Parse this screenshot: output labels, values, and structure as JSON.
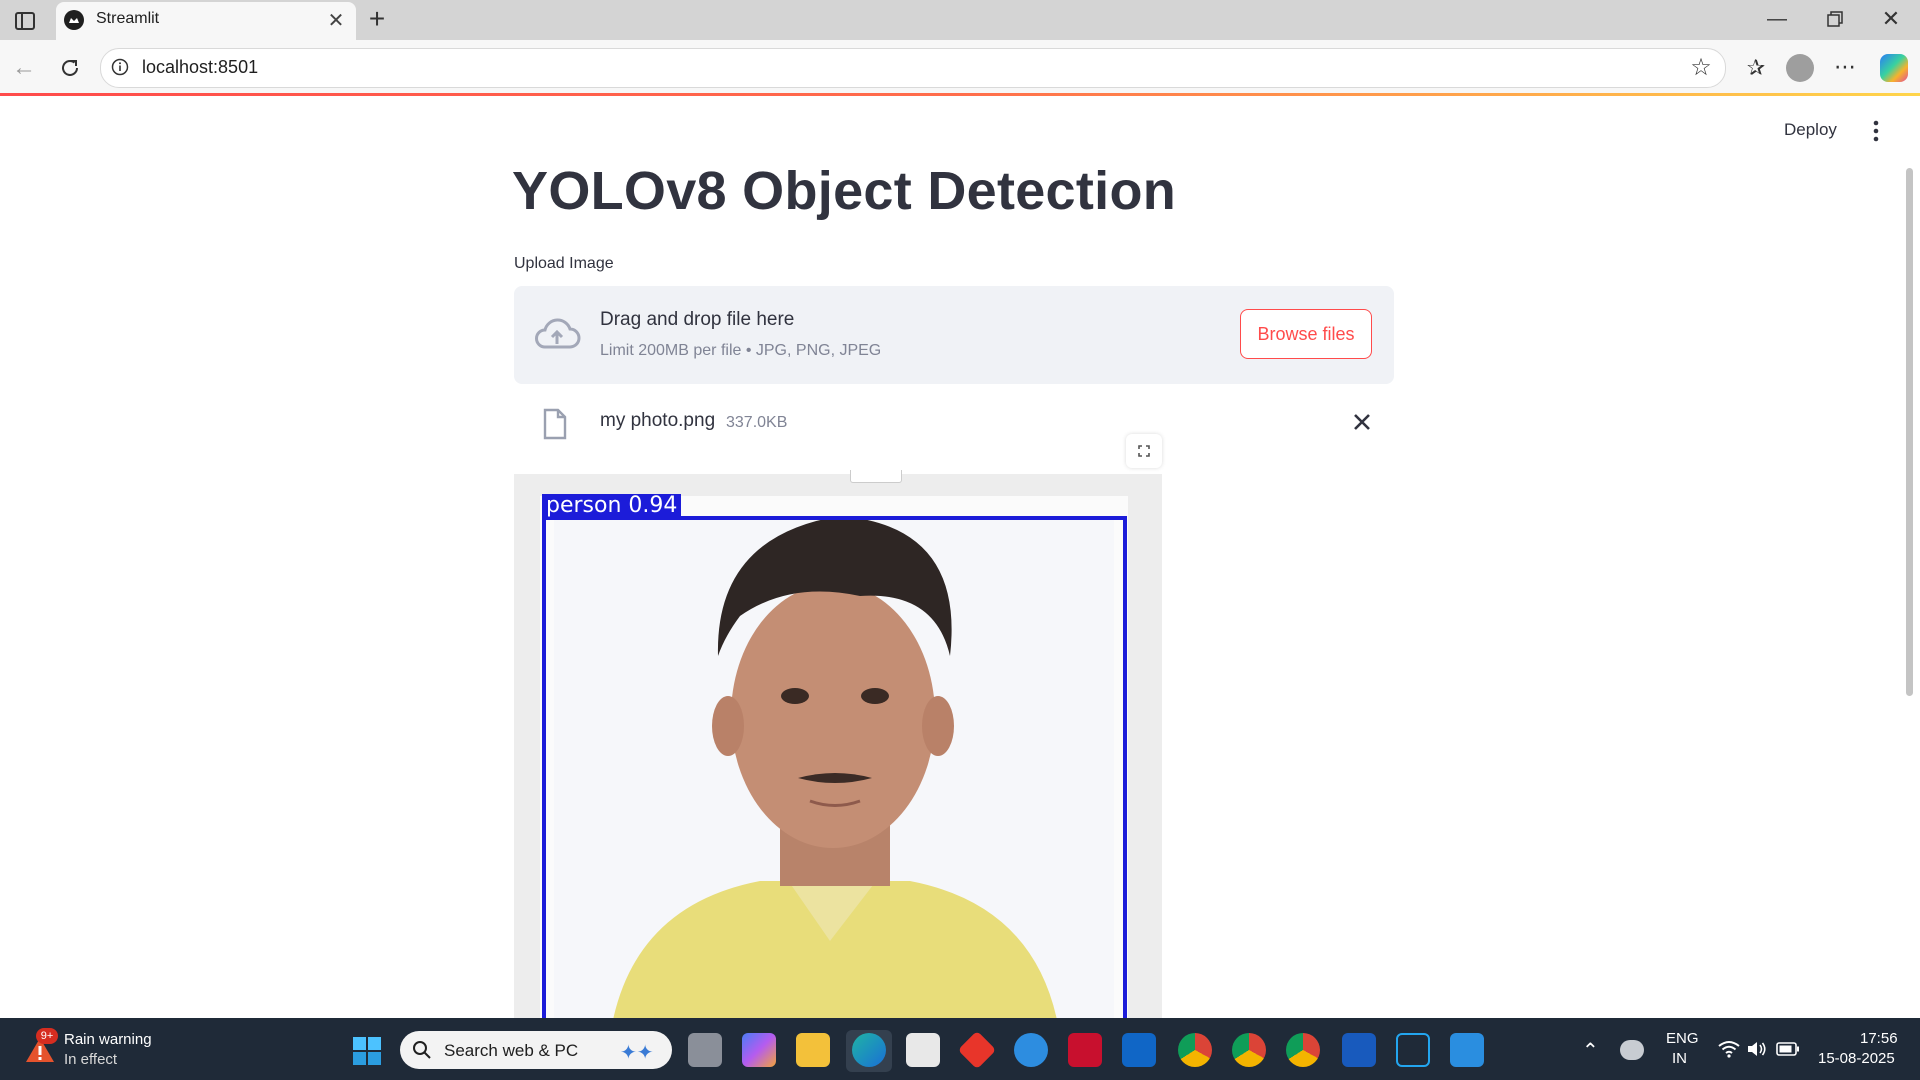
{
  "browser": {
    "tab_title": "Streamlit",
    "url": "localhost:8501"
  },
  "app": {
    "deploy_label": "Deploy",
    "title": "YOLOv8 Object Detection",
    "uploader": {
      "label": "Upload Image",
      "drop_title": "Drag and drop file here",
      "drop_subtitle": "Limit 200MB per file • JPG, PNG, JPEG",
      "browse_label": "Browse files"
    },
    "file": {
      "name": "my photo.png",
      "size": "337.0KB"
    },
    "detection": {
      "label": "person 0.94",
      "box_color": "#1c1cd9"
    }
  },
  "taskbar": {
    "weather_badge": "9+",
    "weather_title": "Rain warning",
    "weather_sub": "In effect",
    "search_placeholder": "Search web & PC",
    "lang_top": "ENG",
    "lang_bottom": "IN",
    "time": "17:56",
    "date": "15-08-2025"
  },
  "colors": {
    "accent": "#ff4b4b",
    "text": "#31333f",
    "muted": "#808495"
  }
}
